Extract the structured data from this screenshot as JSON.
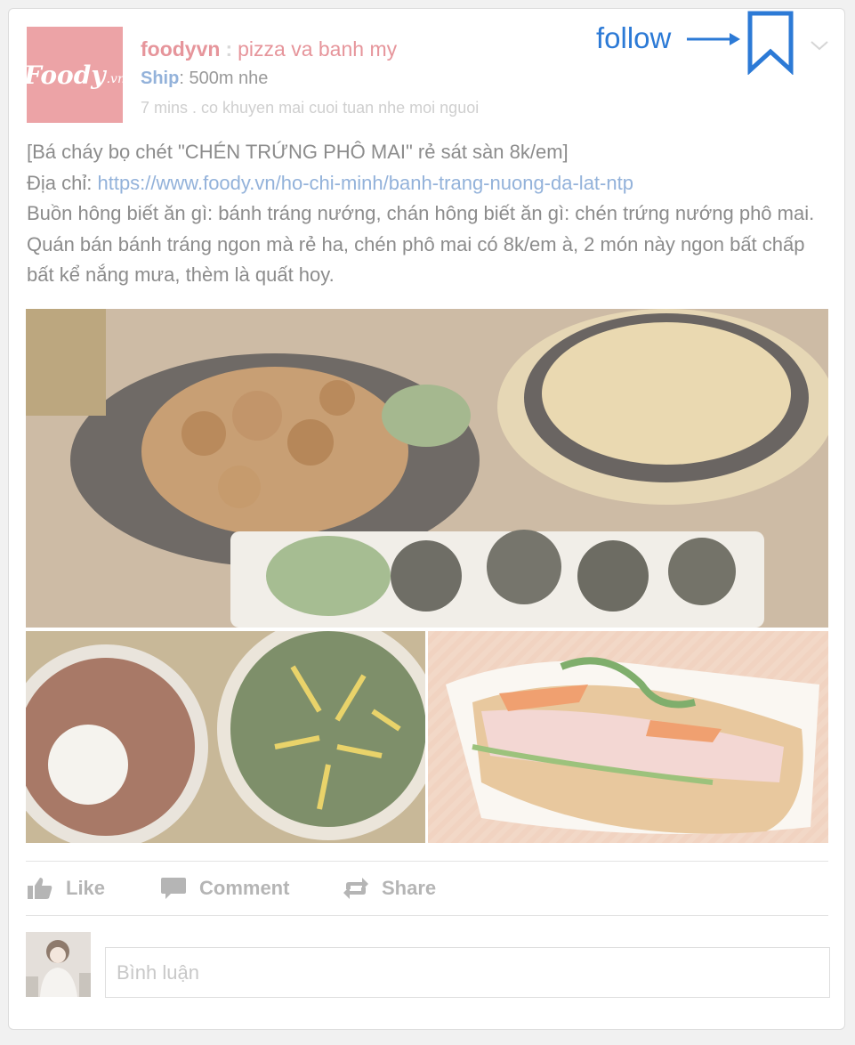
{
  "post": {
    "author": "foodyvn",
    "separator": ":",
    "subtitle": "pizza va banh my",
    "ship_label": "Ship",
    "ship_value": ": 500m nhe",
    "meta": "7 mins . co khuyen mai cuoi tuan nhe moi nguoi",
    "logo": {
      "main": "Foody",
      "suffix": ".vn"
    },
    "follow_label": "follow",
    "title_line": "[Bá cháy bọ chét \"CHÉN TRỨNG PHÔ MAI\" rẻ sát sàn 8k/em]",
    "address_label": "Địa chỉ: ",
    "address_link": "https://www.foody.vn/ho-chi-minh/banh-trang-nuong-da-lat-ntp",
    "description": "Buồn hông biết ăn gì: bánh tráng nướng, chán hông biết ăn gì: chén trứng nướng phô mai. Quán bán bánh tráng ngon mà rẻ ha, chén phô mai có 8k/em à, 2 món này ngon bất chấp bất kể nắng mưa, thèm là quất hoy.",
    "photos": [
      "food-platter-photo",
      "pizza-photo",
      "banh-mi-photo"
    ]
  },
  "actions": {
    "like": "Like",
    "comment": "Comment",
    "share": "Share"
  },
  "comment_box": {
    "placeholder": "Bình luận"
  },
  "icons": {
    "bookmark": "bookmark-icon",
    "chevron": "chevron-down-icon",
    "like": "thumbs-up-icon",
    "comment": "speech-bubble-icon",
    "share": "share-arrows-icon"
  },
  "colors": {
    "brand_pink": "#eca3a6",
    "author_pink": "#e6959b",
    "ship_blue": "#93b2da",
    "follow_blue": "#2c7ad6"
  }
}
